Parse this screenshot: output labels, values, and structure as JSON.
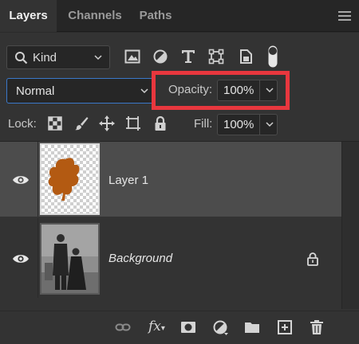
{
  "tabs": [
    {
      "label": "Layers",
      "active": true
    },
    {
      "label": "Channels",
      "active": false
    },
    {
      "label": "Paths",
      "active": false
    }
  ],
  "filter": {
    "kind_label": "Kind",
    "icons": [
      "image-filter-icon",
      "adjustment-filter-icon",
      "type-filter-icon",
      "shape-filter-icon",
      "smart-object-filter-icon",
      "filter-toggle-icon"
    ]
  },
  "blend_mode": "Normal",
  "opacity": {
    "label": "Opacity:",
    "value": "100%"
  },
  "lock": {
    "label": "Lock:",
    "icons": [
      "lock-transparent-pixels-icon",
      "lock-image-pixels-icon",
      "lock-position-icon",
      "artboard-lock-icon",
      "lock-all-icon"
    ]
  },
  "fill": {
    "label": "Fill:",
    "value": "100%"
  },
  "layers": [
    {
      "name": "Layer 1",
      "selected": true,
      "visible": true,
      "locked": false
    },
    {
      "name": "Background",
      "selected": false,
      "visible": true,
      "locked": true
    }
  ],
  "footer_icons": [
    "link-layers-icon",
    "fx-icon",
    "add-mask-icon",
    "adjustment-layer-icon",
    "new-group-icon",
    "new-layer-icon",
    "delete-layer-icon"
  ],
  "colors": {
    "accent_highlight": "#e8373e",
    "focus_border": "#3b78c9",
    "selected_row": "#4c4c4c",
    "panel_bg": "#333333",
    "layer1_shape": "#b35a12"
  }
}
